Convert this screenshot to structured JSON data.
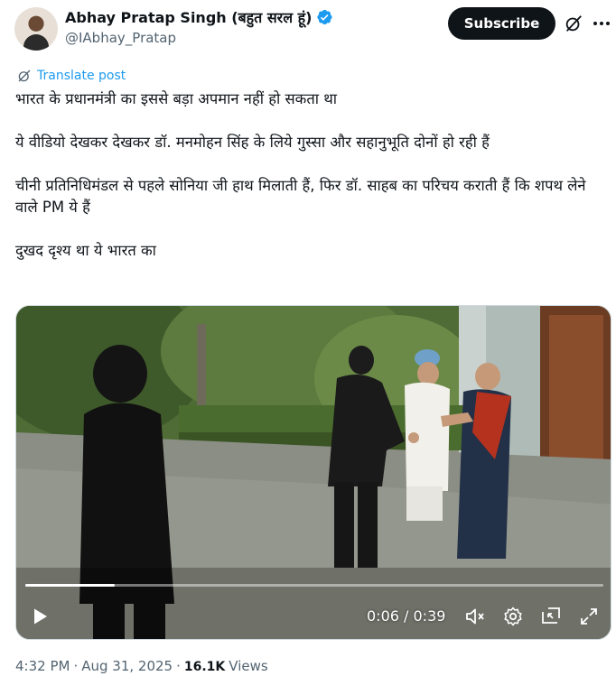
{
  "author": {
    "display_name": "Abhay Pratap Singh (बहुत सरल हूं)",
    "handle": "@IAbhay_Pratap",
    "verified": true
  },
  "actions": {
    "subscribe_label": "Subscribe",
    "grok_icon": "grok-icon",
    "more_icon": "more-icon"
  },
  "translate_label": "Translate post",
  "tweet": {
    "paragraphs": [
      "भारत के प्रधानमंत्री का इससे बड़ा अपमान नहीं हो सकता था",
      "ये वीडियो देखकर देखकर डॉ. मनमोहन सिंह के लिये गुस्सा और सहानुभूति दोनों हो रही हैं",
      "चीनी प्रतिनिधिमंडल से पहले सोनिया जी हाथ मिलाती हैं, फिर डॉ. साहब का परिचय कराती हैं कि शपथ लेने वाले PM ये हैं",
      "दुखद दृश्य था ये भारत का"
    ]
  },
  "video": {
    "current_time": "0:06",
    "duration": "0:39",
    "time_display": "0:06 / 0:39",
    "progress": 0.154
  },
  "meta": {
    "time": "4:32 PM",
    "date": "Aug 31, 2025",
    "views_count": "16.1K",
    "views_label": "Views"
  },
  "colors": {
    "accent": "#1d9bf0",
    "text": "#0f1419",
    "secondary": "#536471",
    "button_bg": "#0f1419"
  }
}
